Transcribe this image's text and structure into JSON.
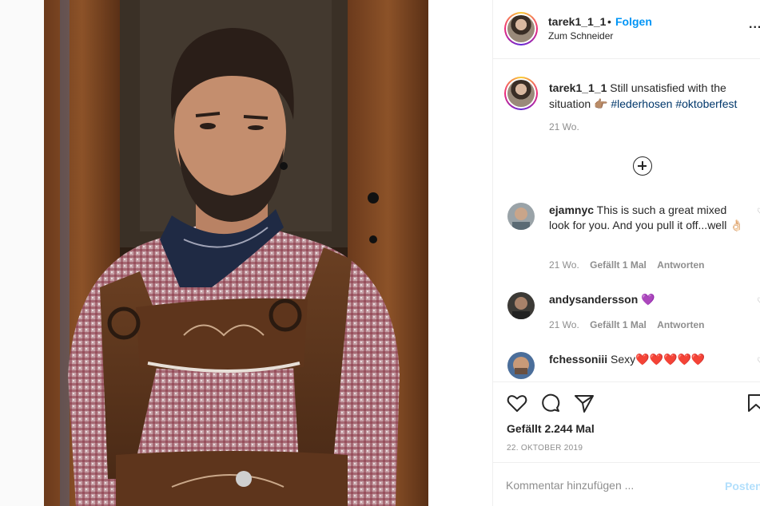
{
  "post": {
    "username": "tarek1_1_1",
    "separator": "•",
    "follow_label": "Folgen",
    "location": "Zum Schneider",
    "more_icon": "more-options-icon",
    "more_label": "..."
  },
  "caption": {
    "username": "tarek1_1_1",
    "line1": " Still unsatisfied with the",
    "line2_text": "situation ",
    "emoji": "👉🏽",
    "hashtags": " #lederhosen #oktoberfest",
    "time": "21 Wo."
  },
  "comments": [
    {
      "username": "ejamnyc",
      "text": " This is such a great mixed look for you. And you pull it off...well ",
      "emoji": "👌🏻",
      "time": "21 Wo.",
      "likes": "Gefällt 1 Mal",
      "reply": "Antworten"
    },
    {
      "username": "andysandersson",
      "text": " ",
      "emoji": "💜",
      "time": "21 Wo.",
      "likes": "Gefällt 1 Mal",
      "reply": "Antworten"
    },
    {
      "username": "fchessoniii",
      "text": " Sexy",
      "emoji": "❤️❤️❤️❤️❤️"
    }
  ],
  "actions": {
    "likes": "Gefällt 2.244 Mal",
    "date": "22. OKTOBER 2019"
  },
  "add_comment": {
    "placeholder": "Kommentar hinzufügen ...",
    "post_label": "Posten"
  },
  "colors": {
    "link_blue": "#0095f6",
    "hashtag_blue": "#00376b",
    "muted": "#8e8e8e",
    "post_disabled": "#b2dffc"
  }
}
